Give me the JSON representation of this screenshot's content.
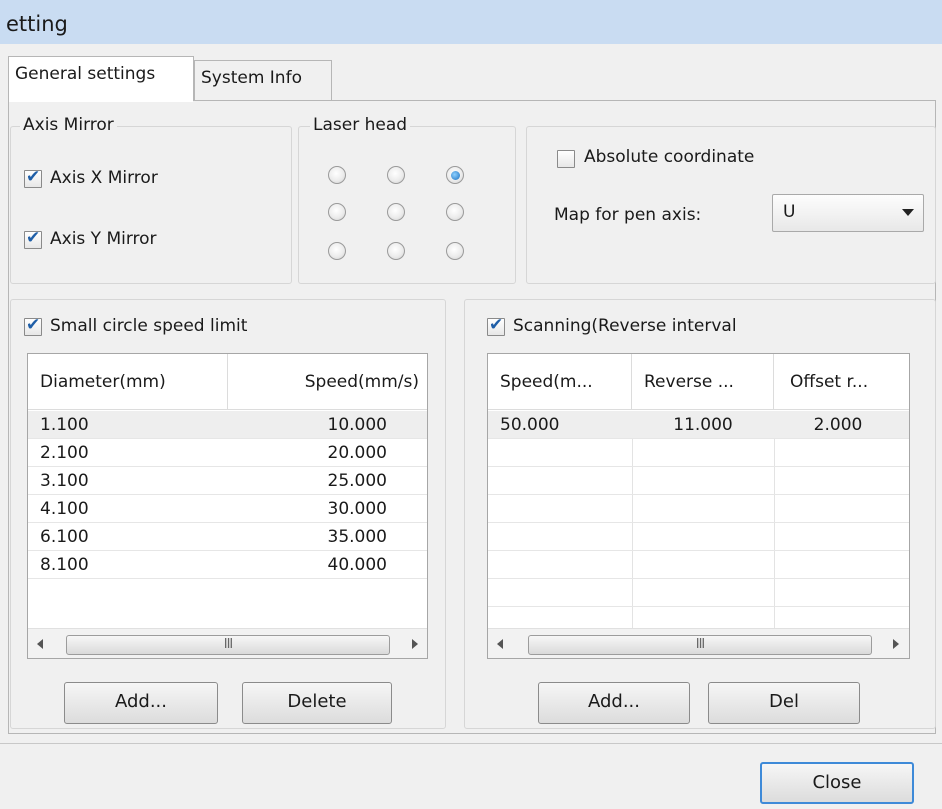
{
  "window": {
    "title": "etting"
  },
  "tabs": [
    {
      "label": "General settings",
      "active": true
    },
    {
      "label": "System Info",
      "active": false
    }
  ],
  "axis_mirror": {
    "title": "Axis Mirror",
    "x_label": "Axis X Mirror",
    "x_checked": true,
    "y_label": "Axis Y Mirror",
    "y_checked": true
  },
  "laser_head": {
    "title": "Laser head",
    "selected": "top-right"
  },
  "coord": {
    "absolute_label": "Absolute coordinate",
    "absolute_checked": false,
    "map_label": "Map for pen axis:",
    "map_value": "U"
  },
  "small_circle": {
    "label": "Small circle speed limit",
    "checked": true,
    "columns": [
      "Diameter(mm)",
      "Speed(mm/s)"
    ],
    "rows": [
      [
        "1.100",
        "10.000"
      ],
      [
        "2.100",
        "20.000"
      ],
      [
        "3.100",
        "25.000"
      ],
      [
        "4.100",
        "30.000"
      ],
      [
        "6.100",
        "35.000"
      ],
      [
        "8.100",
        "40.000"
      ]
    ],
    "scroll_grip": "III",
    "add_label": "Add...",
    "delete_label": "Delete"
  },
  "scanning": {
    "label": "Scanning(Reverse interval",
    "checked": true,
    "columns": [
      "Speed(m...",
      "Reverse ...",
      "Offset r..."
    ],
    "rows": [
      [
        "50.000",
        "11.000",
        "2.000"
      ]
    ],
    "scroll_grip": "III",
    "add_label": "Add...",
    "del_label": "Del"
  },
  "footer": {
    "close_label": "Close"
  }
}
